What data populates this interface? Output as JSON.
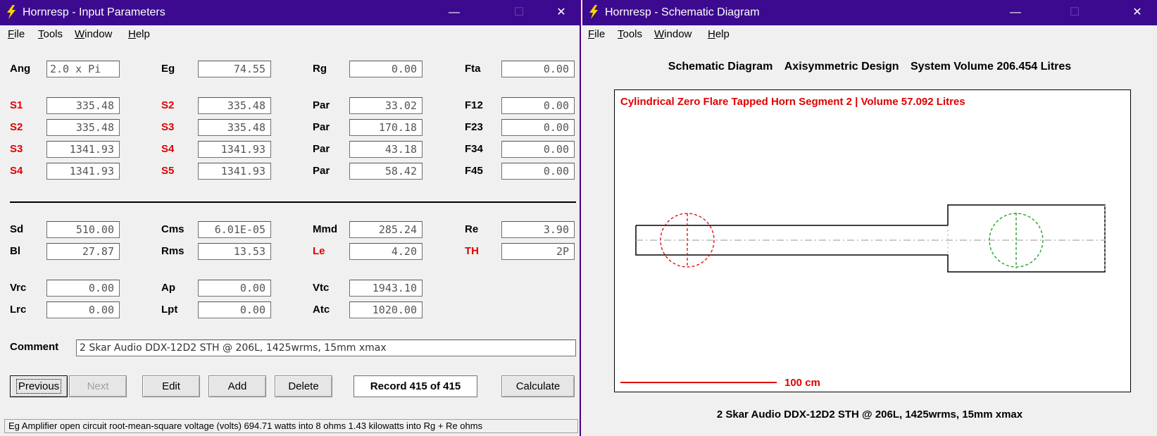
{
  "left_window": {
    "title": "Hornresp - Input Parameters",
    "minimize": "—",
    "maximize": "☐",
    "close": "✕",
    "menu": [
      "File",
      "Tools",
      "Window",
      "Help"
    ],
    "rows": {
      "r0": [
        {
          "label": "Ang",
          "value": "2.0 x Pi",
          "red": false
        },
        {
          "label": "Eg",
          "value": "74.55",
          "red": false
        },
        {
          "label": "Rg",
          "value": "0.00",
          "red": false
        },
        {
          "label": "Fta",
          "value": "0.00",
          "red": false
        }
      ],
      "r1": [
        {
          "label": "S1",
          "value": "335.48",
          "red": true
        },
        {
          "label": "S2",
          "value": "335.48",
          "red": true
        },
        {
          "label": "Par",
          "value": "33.02",
          "red": false
        },
        {
          "label": "F12",
          "value": "0.00",
          "red": false
        }
      ],
      "r2": [
        {
          "label": "S2",
          "value": "335.48",
          "red": true
        },
        {
          "label": "S3",
          "value": "335.48",
          "red": true
        },
        {
          "label": "Par",
          "value": "170.18",
          "red": false
        },
        {
          "label": "F23",
          "value": "0.00",
          "red": false
        }
      ],
      "r3": [
        {
          "label": "S3",
          "value": "1341.93",
          "red": true
        },
        {
          "label": "S4",
          "value": "1341.93",
          "red": true
        },
        {
          "label": "Par",
          "value": "43.18",
          "red": false
        },
        {
          "label": "F34",
          "value": "0.00",
          "red": false
        }
      ],
      "r4": [
        {
          "label": "S4",
          "value": "1341.93",
          "red": true
        },
        {
          "label": "S5",
          "value": "1341.93",
          "red": true
        },
        {
          "label": "Par",
          "value": "58.42",
          "red": false
        },
        {
          "label": "F45",
          "value": "0.00",
          "red": false
        }
      ],
      "r5": [
        {
          "label": "Sd",
          "value": "510.00",
          "red": false
        },
        {
          "label": "Cms",
          "value": "6.01E-05",
          "red": false
        },
        {
          "label": "Mmd",
          "value": "285.24",
          "red": false
        },
        {
          "label": "Re",
          "value": "3.90",
          "red": false
        }
      ],
      "r6": [
        {
          "label": "Bl",
          "value": "27.87",
          "red": false
        },
        {
          "label": "Rms",
          "value": "13.53",
          "red": false
        },
        {
          "label": "Le",
          "value": "4.20",
          "red": true
        },
        {
          "label": "TH",
          "value": "2P",
          "red": true
        }
      ],
      "r7": [
        {
          "label": "Vrc",
          "value": "0.00",
          "red": false
        },
        {
          "label": "Ap",
          "value": "0.00",
          "red": false
        },
        {
          "label": "Vtc",
          "value": "1943.10",
          "red": false
        }
      ],
      "r8": [
        {
          "label": "Lrc",
          "value": "0.00",
          "red": false
        },
        {
          "label": "Lpt",
          "value": "0.00",
          "red": false
        },
        {
          "label": "Atc",
          "value": "1020.00",
          "red": false
        }
      ]
    },
    "comment_label": "Comment",
    "comment_value": "2 Skar Audio DDX-12D2 STH @ 206L, 1425wrms, 15mm xmax",
    "buttons": {
      "previous": "Previous",
      "next": "Next",
      "edit": "Edit",
      "add": "Add",
      "delete": "Delete",
      "calculate": "Calculate"
    },
    "record": "Record 415 of 415",
    "status": "Eg  Amplifier open circuit root-mean-square voltage  (volts)   694.71 watts into 8 ohms   1.43 kilowatts into Rg + Re ohms"
  },
  "right_window": {
    "title": "Hornresp - Schematic Diagram",
    "minimize": "—",
    "maximize": "☐",
    "close": "✕",
    "menu": [
      "File",
      "Tools",
      "Window",
      "Help"
    ],
    "header": [
      "Schematic Diagram",
      "Axisymmetric Design",
      "System Volume 206.454 Litres"
    ],
    "caption": "Cylindrical Zero Flare Tapped Horn Segment 2 | Volume 57.092 Litres",
    "scale_label": "100 cm",
    "footer": "2 Skar Audio DDX-12D2 STH @ 206L, 1425wrms, 15mm xmax"
  },
  "colors": {
    "titlebar": "#3c0a8f",
    "label_red": "#e00000",
    "driver_red": "#e00000",
    "driver_green": "#1a9a1a"
  }
}
